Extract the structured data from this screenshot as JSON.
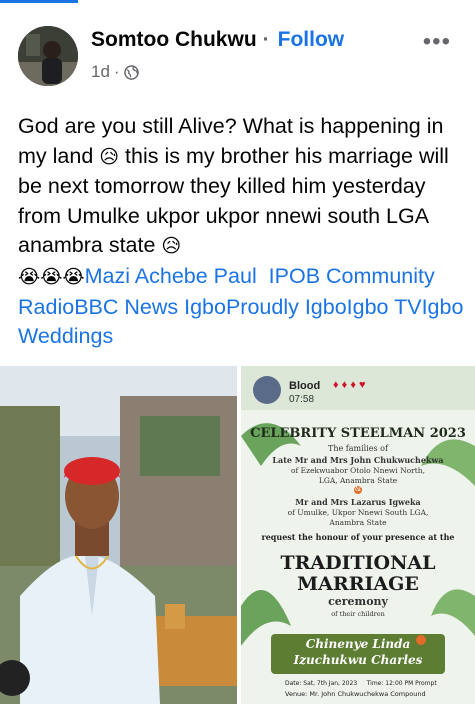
{
  "post": {
    "author": "Somtoo Chukwu",
    "follow_label": "Follow",
    "time": "1d",
    "more_label": "•••",
    "text_main": "God are you still Alive? What is happening in my land ",
    "text_2": " this is my brother his marriage will be next tomorrow they killed him yesterday from Umulke ukpor ukpor nnewi south LGA anambra state ",
    "emoji_sad": "😥",
    "emoji_cry": "😭",
    "tags": [
      "Mazi Achebe Paul",
      "IPOB Community Radio",
      "BBC News Igbo",
      "Proudly Igbo",
      "Igbo TV",
      "Igbo Weddings"
    ]
  },
  "invite": {
    "story_name": "Blood",
    "story_time": "07:58",
    "header": "CELEBRITY STEELMAN 2023",
    "line1": "The families of",
    "line2": "Late Mr and Mrs John Chukwuchekwa",
    "line3": "of Ezekwuabor Otolo Nnewi North,",
    "line4": "LGA, Anambra State",
    "amp": "&",
    "line5": "Mr and Mrs Lazarus Igweka",
    "line6": "of Umulke, Ukpor Nnewi South LGA,",
    "line7": "Anambra State",
    "request": "request the honour of your presence at the",
    "title1": "TRADITIONAL",
    "title2": "MARRIAGE",
    "title3": "ceremony",
    "of_children": "of their children",
    "couple1": "Chinenye Linda",
    "couple2": "Izuchukwu Charles",
    "date_line": "Date: Sat, 7th Jan, 2023     Time: 12:00 PM Prompt",
    "venue_line": "Venue: Mr. John Chukwuchekwa Compound"
  },
  "colors": {
    "accent": "#1b74e4",
    "muted": "#65676b",
    "banner": "#6b8a3a",
    "cap": "#d62828"
  }
}
